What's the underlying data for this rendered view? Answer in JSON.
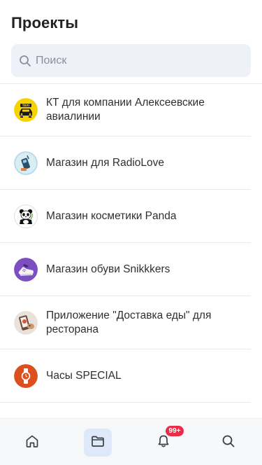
{
  "header": {
    "title": "Проекты"
  },
  "search": {
    "placeholder": "Поиск"
  },
  "projects": [
    {
      "label": "КТ для компании Алексеевские авиалинии",
      "icon": "taxi-avatar"
    },
    {
      "label": "Магазин для RadioLove",
      "icon": "radio-avatar"
    },
    {
      "label": "Магазин косметики Panda",
      "icon": "panda-avatar"
    },
    {
      "label": "Магазин обуви Snikkkers",
      "icon": "sneakers-avatar"
    },
    {
      "label": "Приложение \"Доставка еды\" для ресторана",
      "icon": "food-avatar"
    },
    {
      "label": "Часы SPECIAL",
      "icon": "watch-avatar"
    }
  ],
  "bottom_nav": {
    "tabs": [
      {
        "name": "home",
        "icon": "home-icon"
      },
      {
        "name": "projects",
        "icon": "folder-icon",
        "active": true
      },
      {
        "name": "notifications",
        "icon": "bell-icon"
      },
      {
        "name": "search",
        "icon": "search-icon"
      }
    ],
    "notifications_badge": "99+"
  },
  "colors": {
    "accent": "#dde8f8",
    "badge": "#ea2c47",
    "search_bg": "#eef1f8"
  }
}
